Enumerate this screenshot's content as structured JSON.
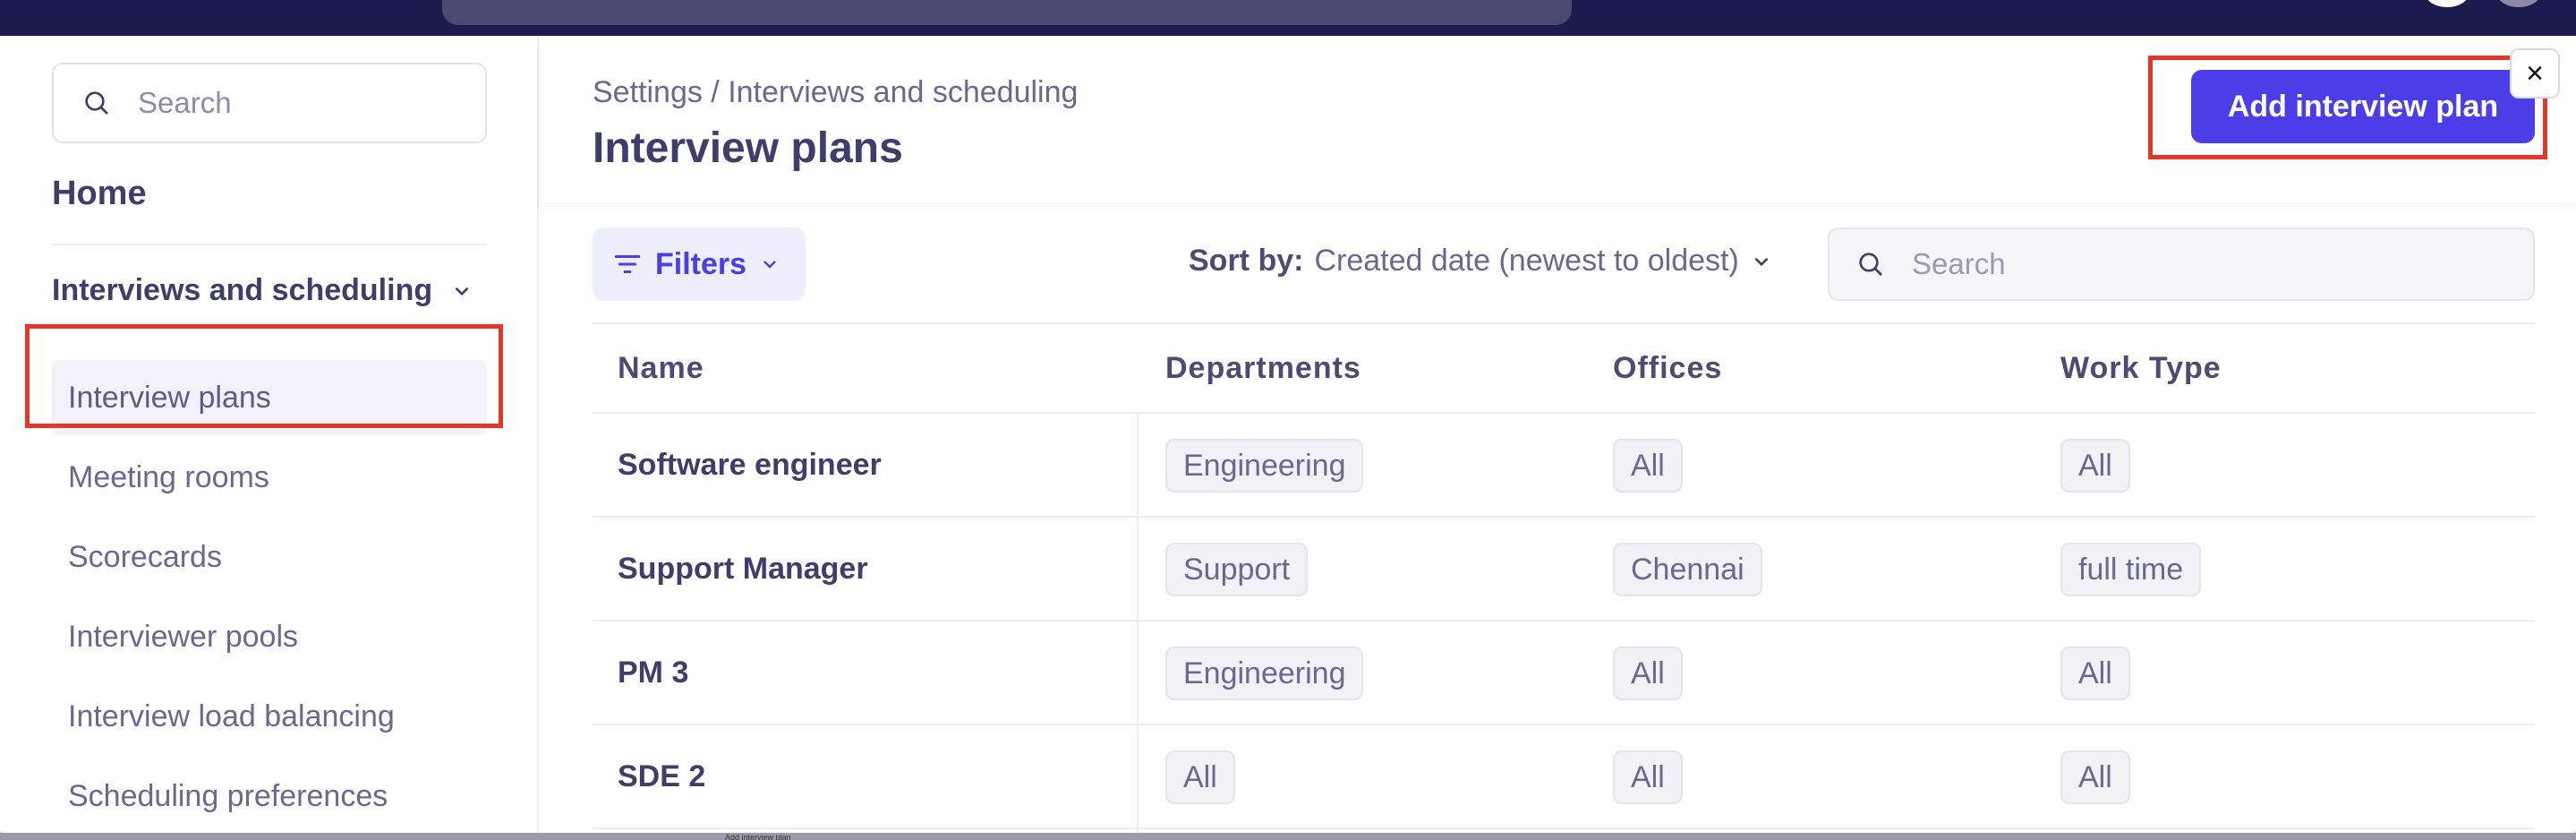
{
  "sidebar": {
    "search_placeholder": "Search",
    "home": "Home",
    "section": "Interviews and scheduling",
    "items": [
      {
        "label": "Interview plans",
        "active": true
      },
      {
        "label": "Meeting rooms",
        "active": false
      },
      {
        "label": "Scorecards",
        "active": false
      },
      {
        "label": "Interviewer pools",
        "active": false
      },
      {
        "label": "Interview load balancing",
        "active": false
      },
      {
        "label": "Scheduling preferences",
        "active": false
      }
    ]
  },
  "header": {
    "breadcrumb": "Settings / Interviews and scheduling",
    "title": "Interview plans",
    "add_button": "Add interview plan",
    "close_icon": "close-icon"
  },
  "toolbar": {
    "filters_label": "Filters",
    "sort_label": "Sort by:",
    "sort_value": "Created date (newest to oldest)",
    "search_placeholder": "Search"
  },
  "table": {
    "columns": [
      "Name",
      "Departments",
      "Offices",
      "Work Type"
    ],
    "rows": [
      {
        "name": "Software engineer",
        "department": "Engineering",
        "office": "All",
        "work_type": "All"
      },
      {
        "name": "Support Manager",
        "department": "Support",
        "office": "Chennai",
        "work_type": "full time"
      },
      {
        "name": "PM 3",
        "department": "Engineering",
        "office": "All",
        "work_type": "All"
      },
      {
        "name": "SDE 2",
        "department": "All",
        "office": "All",
        "work_type": "All"
      }
    ]
  },
  "bottom_label": "Add interview plan",
  "colors": {
    "accent": "#4b3ee8",
    "highlight": "#e2382b",
    "text": "#3f3d6b",
    "topbar": "#1c1b4d"
  }
}
